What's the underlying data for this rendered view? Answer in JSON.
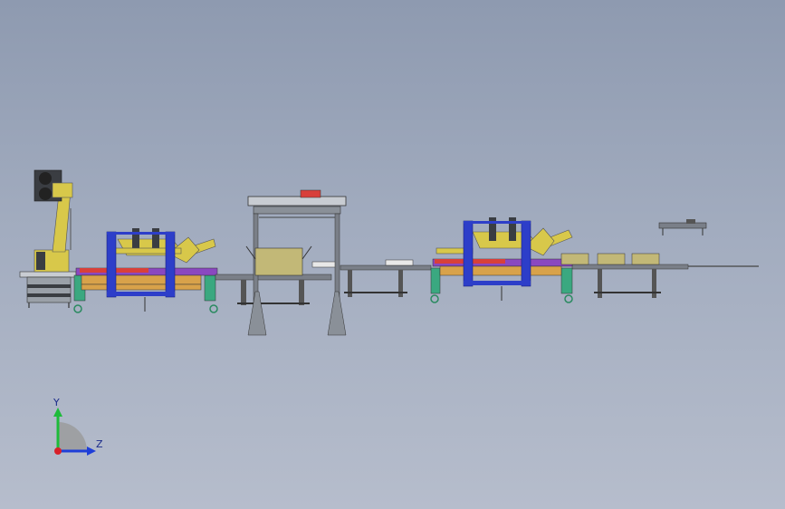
{
  "viewport": {
    "background_top": "#8e9ab0",
    "background_bottom": "#b6bdcc"
  },
  "triad": {
    "y_label": "Y",
    "z_label": "Z",
    "y_color": "#1dbb3a",
    "z_color": "#1e3ed8",
    "x_color": "#d8202a"
  },
  "colors": {
    "robot_yellow": "#d8c84a",
    "frame_blue": "#2d3ec9",
    "conveyor_grey": "#7a7f88",
    "belt_red": "#d8403a",
    "belt_orange": "#d8a24a",
    "belt_purple": "#8a48c0",
    "leg_green": "#3aa880",
    "box_khaki": "#c2b877"
  },
  "icons": {
    "robot": "industrial-robot-icon",
    "gantry": "gantry-frame-icon"
  }
}
